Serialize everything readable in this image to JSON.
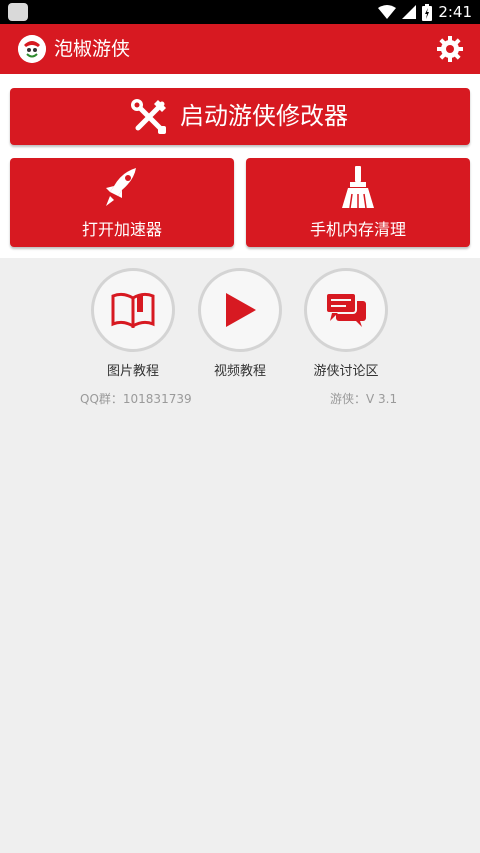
{
  "status_bar": {
    "time": "2:41"
  },
  "app_bar": {
    "title": "泡椒游侠"
  },
  "launch_button": {
    "label": "启动游侠修改器"
  },
  "tiles": [
    {
      "label": "打开加速器",
      "icon": "rocket-icon"
    },
    {
      "label": "手机内存清理",
      "icon": "broom-icon"
    }
  ],
  "circles": [
    {
      "label": "图片教程",
      "icon": "book-icon"
    },
    {
      "label": "视频教程",
      "icon": "play-icon"
    },
    {
      "label": "游侠讨论区",
      "icon": "chat-bubbles-icon"
    }
  ],
  "info": {
    "qq": "QQ群：101831739",
    "version": "游侠：V 3.1"
  },
  "colors": {
    "primary": "#d71921",
    "background": "#efefef"
  }
}
